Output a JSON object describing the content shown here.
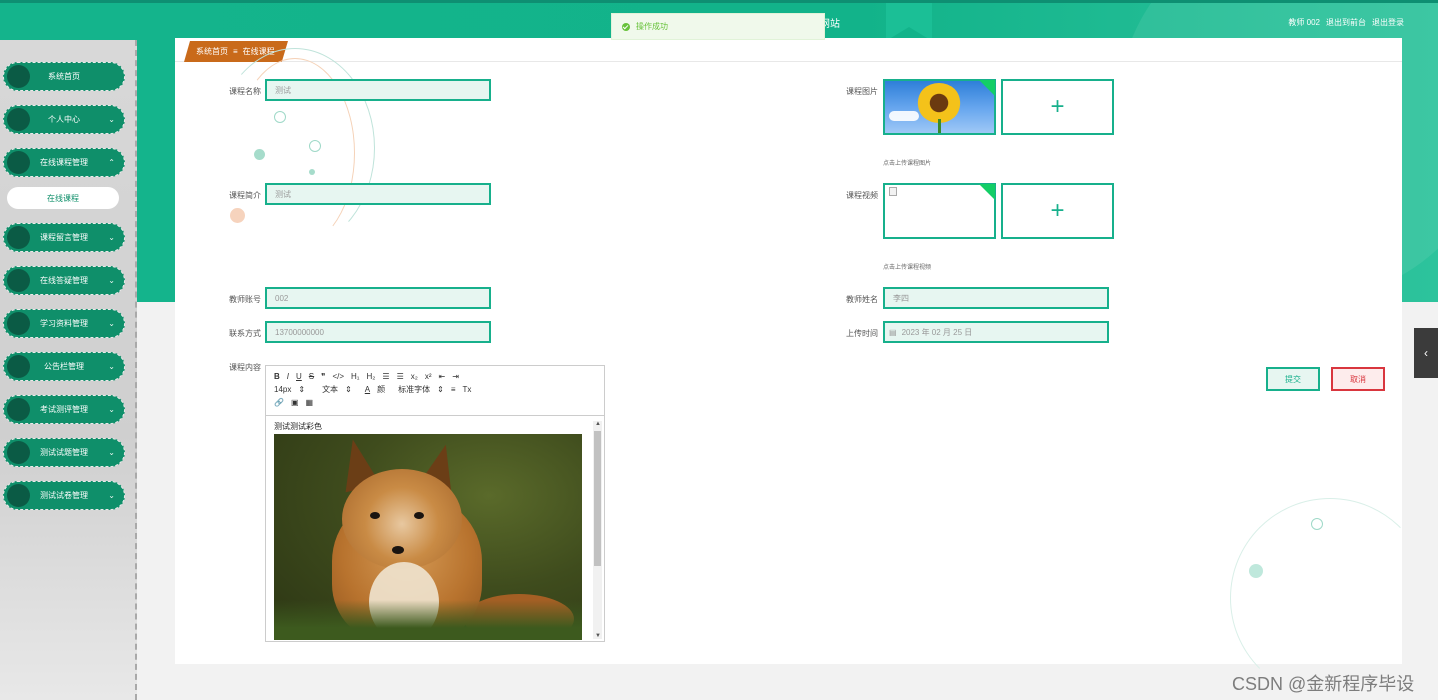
{
  "header": {
    "title": "网站",
    "links": [
      "教师 002",
      "退出到前台",
      "退出登录"
    ]
  },
  "toast": {
    "message": "操作成功"
  },
  "sidebar": {
    "items": [
      {
        "label": "系统首页",
        "chevron": ""
      },
      {
        "label": "个人中心",
        "chevron": "⌄"
      },
      {
        "label": "在线课程管理",
        "chevron": "⌃"
      },
      {
        "label": "课程留言管理",
        "chevron": "⌄"
      },
      {
        "label": "在线答疑管理",
        "chevron": "⌄"
      },
      {
        "label": "学习资料管理",
        "chevron": "⌄"
      },
      {
        "label": "公告栏管理",
        "chevron": "⌄"
      },
      {
        "label": "考试测评管理",
        "chevron": "⌄"
      },
      {
        "label": "测试试题管理",
        "chevron": "⌄"
      },
      {
        "label": "测试试卷管理",
        "chevron": "⌄"
      }
    ],
    "subitem": "在线课程"
  },
  "breadcrumb": {
    "home": "系统首页",
    "sep": "≡",
    "current": "在线课程"
  },
  "form": {
    "course_name": {
      "label": "课程名称",
      "value": "测试"
    },
    "course_intro": {
      "label": "课程简介",
      "value": "测试"
    },
    "teacher_account": {
      "label": "教师账号",
      "value": "002"
    },
    "contact": {
      "label": "联系方式",
      "value": "13700000000"
    },
    "content": {
      "label": "课程内容"
    },
    "course_image": {
      "label": "课程图片",
      "hint": "点击上传课程图片",
      "plus": "+"
    },
    "course_video": {
      "label": "课程视频",
      "hint": "点击上传课程视频",
      "plus": "+"
    },
    "teacher_name": {
      "label": "教师姓名",
      "value": "李四"
    },
    "upload_time": {
      "label": "上传时间",
      "value": "2023 年 02 月 25 日"
    }
  },
  "editor": {
    "toolbar_row1": [
      "B",
      "I",
      "U",
      "S",
      "❞",
      "</>",
      "H₁",
      "H₂",
      "☰",
      "☰",
      "x₂",
      "x²",
      "⇤",
      "⇥"
    ],
    "toolbar_row2": [
      "14px",
      "⇕",
      "文本",
      "⇕",
      "A",
      "颜",
      "标准字体",
      "⇕",
      "≡",
      "Tx"
    ],
    "toolbar_row3": [
      "🔗",
      "▣",
      "▦"
    ],
    "content_text": "测试测试彩色"
  },
  "buttons": {
    "submit": "提交",
    "cancel": "取消"
  },
  "side_tab": "‹",
  "watermark": "CSDN @金新程序毕设",
  "colors": {
    "primary": "#17b08c",
    "danger": "#d9363e",
    "crumb": "#c96a1a"
  }
}
